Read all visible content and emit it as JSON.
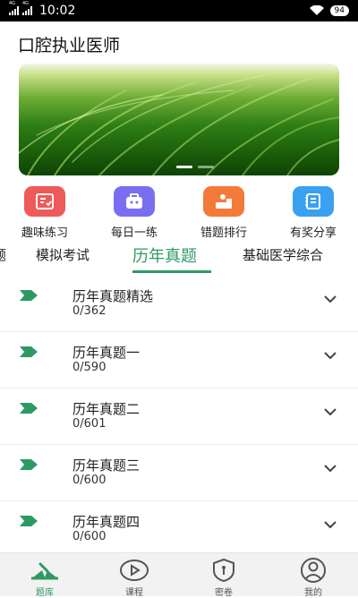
{
  "status_bar": {
    "network1": "4G",
    "network2": "4G",
    "time": "10:02",
    "battery": "94"
  },
  "header": {
    "title": "口腔执业医师"
  },
  "banner": {
    "slides": 2,
    "active_slide": 1
  },
  "quick_actions": [
    {
      "label": "趣味练习",
      "icon": "quiz-card-icon",
      "color": "#f0595a"
    },
    {
      "label": "每日一练",
      "icon": "briefcase-face-icon",
      "color": "#7a6ef0"
    },
    {
      "label": "错题排行",
      "icon": "ranking-person-icon",
      "color": "#f47a3a"
    },
    {
      "label": "有奖分享",
      "icon": "notebook-icon",
      "color": "#3aa0f0"
    }
  ],
  "tabs": [
    {
      "label": "题"
    },
    {
      "label": "模拟考试"
    },
    {
      "label": "历年真题",
      "active": true
    },
    {
      "label": "基础医学综合"
    }
  ],
  "accent_color": "#2e9a63",
  "papers": [
    {
      "title": "历年真题精选",
      "progress": "0/362"
    },
    {
      "title": "历年真题一",
      "progress": "0/590"
    },
    {
      "title": "历年真题二",
      "progress": "0/601"
    },
    {
      "title": "历年真题三",
      "progress": "0/600"
    },
    {
      "title": "历年真题四",
      "progress": "0/600"
    }
  ],
  "bottom_nav": [
    {
      "label": "题库",
      "icon": "question-bank-icon",
      "active": true
    },
    {
      "label": "课程",
      "icon": "play-course-icon"
    },
    {
      "label": "密卷",
      "icon": "secret-paper-shield-icon"
    },
    {
      "label": "我的",
      "icon": "profile-icon"
    }
  ]
}
